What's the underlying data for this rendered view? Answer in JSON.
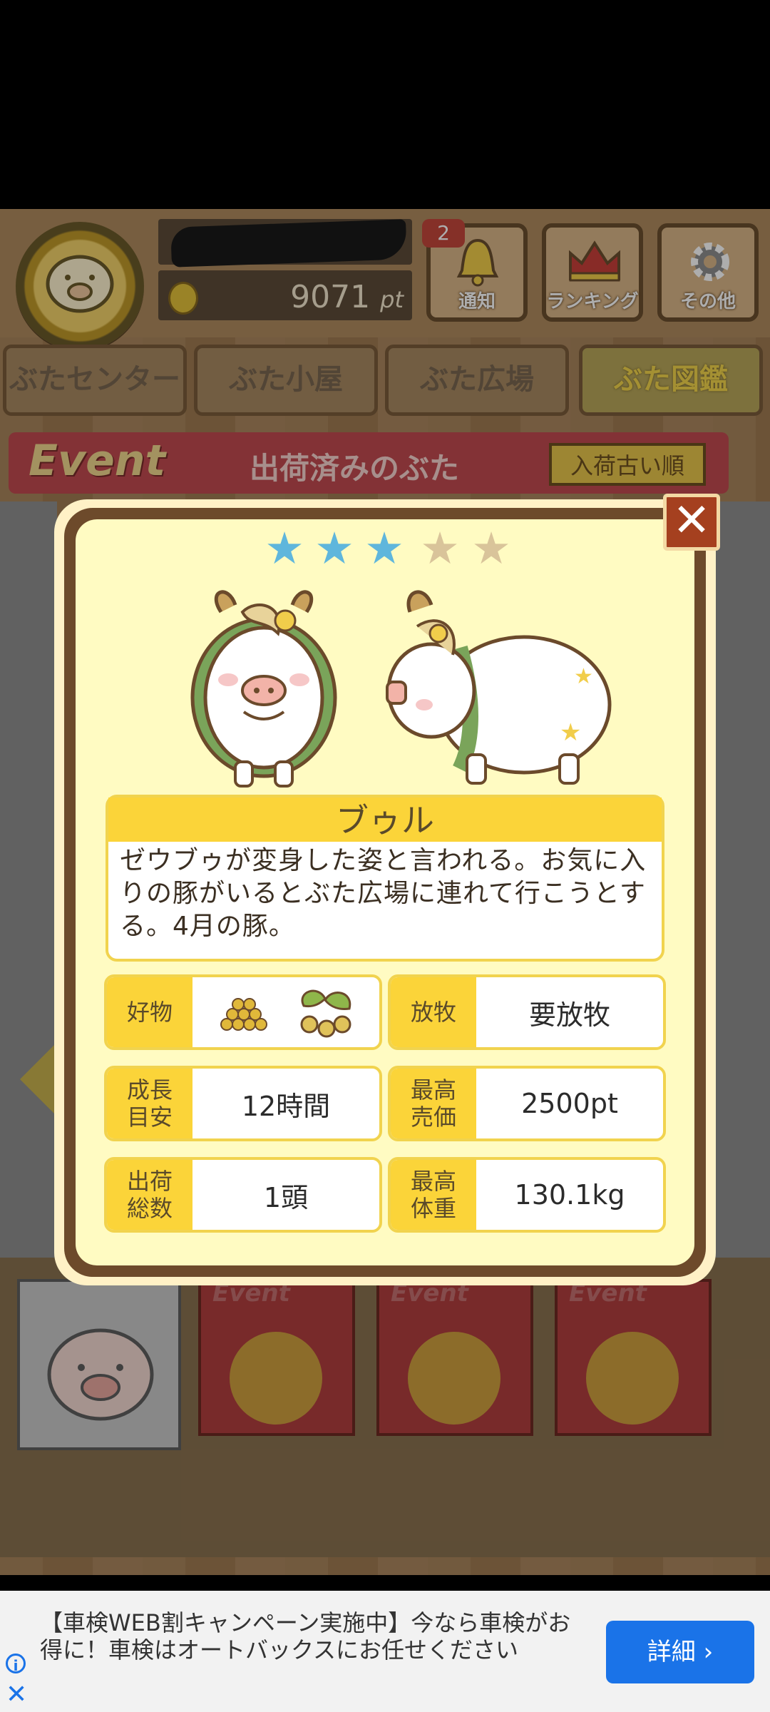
{
  "header": {
    "points_value": "9071",
    "points_unit": "pt",
    "notification_badge": "2",
    "buttons": [
      {
        "label": "通知",
        "icon": "bell-icon"
      },
      {
        "label": "ランキング",
        "icon": "crown-icon"
      },
      {
        "label": "その他",
        "icon": "gear-icon"
      }
    ]
  },
  "tabs": [
    {
      "label": "ぶたセンター"
    },
    {
      "label": "ぶた小屋"
    },
    {
      "label": "ぶた広場"
    },
    {
      "label": "ぶた図鑑",
      "active": true
    }
  ],
  "event_bar": {
    "event_word": "Event",
    "title": "出荷済みのぶた",
    "sort_label": "入荷古い順"
  },
  "bottom_cards": [
    {
      "event_word": "Event"
    },
    {
      "event_word": "Event"
    },
    {
      "event_word": "Event"
    }
  ],
  "modal": {
    "close_label": "✕",
    "rating": 3,
    "rating_max": 5,
    "pig_name": "ブゥル",
    "description": "ゼウブゥが変身した姿と言われる。お気に入りの豚がいるとぶた広場に連れて行こうとする。4月の豚。",
    "stats": {
      "favorite_label": "好物",
      "grazing_label": "放牧",
      "grazing_value": "要放牧",
      "growth_label": "成長\n目安",
      "growth_value": "12時間",
      "max_price_label": "最高\n売価",
      "max_price_value": "2500pt",
      "shipped_label": "出荷\n総数",
      "shipped_value": "1頭",
      "max_weight_label": "最高\n体重",
      "max_weight_value": "130.1kg"
    }
  },
  "ad": {
    "text": "【車検WEB割キャンペーン実施中】今なら車検がお得に！車検はオートバックスにお任せください",
    "button_label": "詳細 ›",
    "info_label": "i",
    "close_label": "✕"
  },
  "colors": {
    "accent_yellow": "#fbd439",
    "star_on": "#5fb6dc",
    "star_off": "#d9c49a",
    "event_red": "#c24a50",
    "ad_button": "#1a73e8"
  }
}
